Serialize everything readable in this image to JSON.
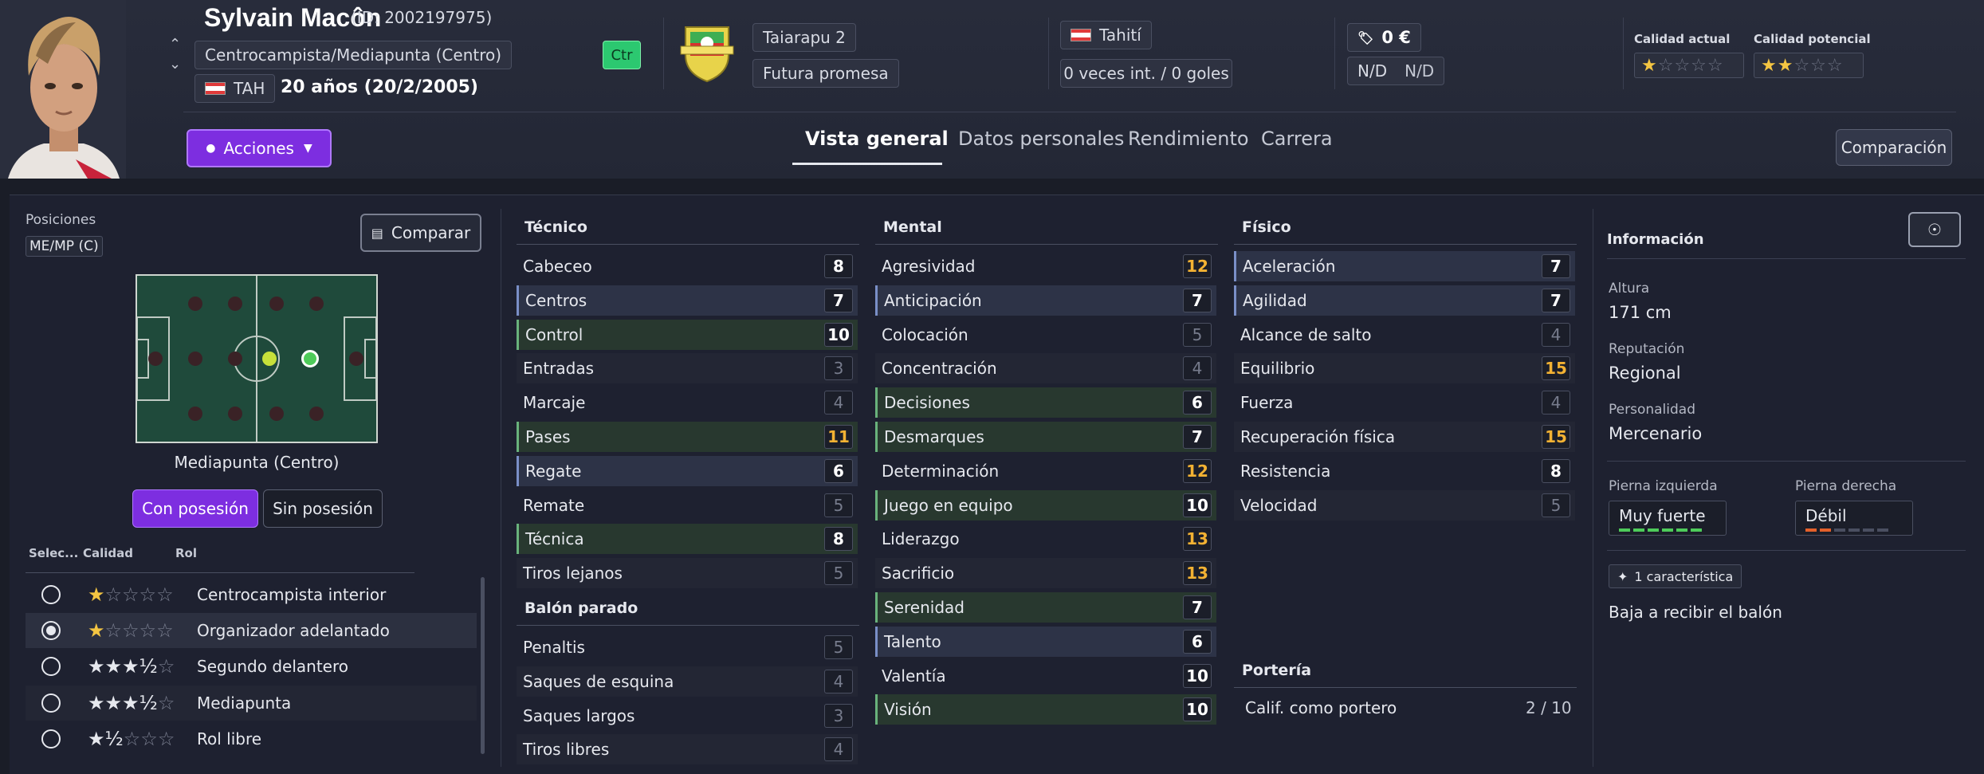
{
  "player": {
    "name": "Sylvain Macôn",
    "id": "(ID: 2002197975)",
    "position": "Centrocampista/Mediapunta (Centro)",
    "nationality_code": "TAH",
    "age": "20 años (20/2/2005)",
    "role_badge": "Ctr",
    "club": "Taiarapu 2",
    "status": "Futura promesa",
    "country": "Tahití",
    "international": "0 veces int. / 0 goles",
    "value": "0 €",
    "wage_1": "N/D",
    "wage_2": "N/D",
    "current_ability_label": "Calidad actual",
    "potential_ability_label": "Calidad potencial",
    "current_stars": 1,
    "potential_stars": 2
  },
  "header": {
    "actions_label": "Acciones",
    "compare_label": "Comparación",
    "tabs": [
      "Vista general",
      "Datos personales",
      "Rendimiento",
      "Carrera"
    ]
  },
  "positions": {
    "title": "Posiciones",
    "code": "ME/MP (C)",
    "compare_button": "Comparar",
    "selected_position": "Mediapunta (Centro)",
    "with_ball": "Con posesión",
    "without_ball": "Sin posesión",
    "col_select": "Selec...",
    "col_quality": "Calidad",
    "col_role": "Rol",
    "roles": [
      {
        "name": "Centrocampista interior",
        "stars": "★☆☆☆☆",
        "selected": false
      },
      {
        "name": "Organizador adelantado",
        "stars": "★☆☆☆☆",
        "selected": true
      },
      {
        "name": "Segundo delantero",
        "stars": "★★★½☆",
        "selected": false
      },
      {
        "name": "Mediapunta",
        "stars": "★★★½☆",
        "selected": false
      },
      {
        "name": "Rol libre",
        "stars": "★½☆☆☆",
        "selected": false
      }
    ]
  },
  "attributes": {
    "technical_title": "Técnico",
    "technical": [
      {
        "name": "Cabeceo",
        "value": "8"
      },
      {
        "name": "Centros",
        "value": "7"
      },
      {
        "name": "Control",
        "value": "10"
      },
      {
        "name": "Entradas",
        "value": "3"
      },
      {
        "name": "Marcaje",
        "value": "4"
      },
      {
        "name": "Pases",
        "value": "11"
      },
      {
        "name": "Regate",
        "value": "6"
      },
      {
        "name": "Remate",
        "value": "5"
      },
      {
        "name": "Técnica",
        "value": "8"
      },
      {
        "name": "Tiros lejanos",
        "value": "5"
      }
    ],
    "set_pieces_title": "Balón parado",
    "set_pieces": [
      {
        "name": "Penaltis",
        "value": "5"
      },
      {
        "name": "Saques de esquina",
        "value": "4"
      },
      {
        "name": "Saques largos",
        "value": "3"
      },
      {
        "name": "Tiros libres",
        "value": "4"
      }
    ],
    "mental_title": "Mental",
    "mental": [
      {
        "name": "Agresividad",
        "value": "12"
      },
      {
        "name": "Anticipación",
        "value": "7"
      },
      {
        "name": "Colocación",
        "value": "5"
      },
      {
        "name": "Concentración",
        "value": "4"
      },
      {
        "name": "Decisiones",
        "value": "6"
      },
      {
        "name": "Desmarques",
        "value": "7"
      },
      {
        "name": "Determinación",
        "value": "12"
      },
      {
        "name": "Juego en equipo",
        "value": "10"
      },
      {
        "name": "Liderazgo",
        "value": "13"
      },
      {
        "name": "Sacrificio",
        "value": "13"
      },
      {
        "name": "Serenidad",
        "value": "7"
      },
      {
        "name": "Talento",
        "value": "6"
      },
      {
        "name": "Valentía",
        "value": "10"
      },
      {
        "name": "Visión",
        "value": "10"
      }
    ],
    "physical_title": "Físico",
    "physical": [
      {
        "name": "Aceleración",
        "value": "7"
      },
      {
        "name": "Agilidad",
        "value": "7"
      },
      {
        "name": "Alcance de salto",
        "value": "4"
      },
      {
        "name": "Equilibrio",
        "value": "15"
      },
      {
        "name": "Fuerza",
        "value": "4"
      },
      {
        "name": "Recuperación física",
        "value": "15"
      },
      {
        "name": "Resistencia",
        "value": "8"
      },
      {
        "name": "Velocidad",
        "value": "5"
      }
    ],
    "goalkeeping_title": "Portería",
    "goalkeeper_rating_label": "Calif. como portero",
    "goalkeeper_rating": "2 / 10"
  },
  "info": {
    "title": "Información",
    "height_label": "Altura",
    "height": "171 cm",
    "reputation_label": "Reputación",
    "reputation": "Regional",
    "personality_label": "Personalidad",
    "personality": "Mercenario",
    "left_foot_label": "Pierna izquierda",
    "left_foot": "Muy fuerte",
    "right_foot_label": "Pierna derecha",
    "right_foot": "Débil",
    "traits_badge": "1 característica",
    "trait": "Baja a recibir el balón"
  },
  "colors": {
    "accent": "#7d2ee0",
    "good": "#4ecb5a",
    "weak": "#e4602b",
    "highlight": "#f3b233"
  }
}
